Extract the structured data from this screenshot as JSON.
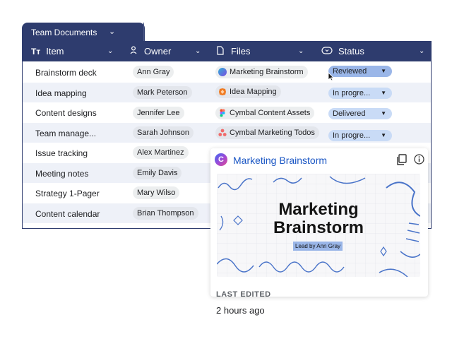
{
  "tab": {
    "label": "Team Documents"
  },
  "columns": [
    {
      "label": "Item",
      "icon": "text-type-icon"
    },
    {
      "label": "Owner",
      "icon": "person-icon"
    },
    {
      "label": "Files",
      "icon": "file-icon"
    },
    {
      "label": "Status",
      "icon": "toggle-status-icon"
    }
  ],
  "rows": [
    {
      "item": "Brainstorm deck",
      "owner": "Ann Gray",
      "file": "Marketing Brainstorm",
      "status": "Reviewed"
    },
    {
      "item": "Idea mapping",
      "owner": "Mark Peterson",
      "file": "Idea Mapping",
      "status": "In progre..."
    },
    {
      "item": "Content designs",
      "owner": "Jennifer Lee",
      "file": "Cymbal Content Assets",
      "status": "Delivered"
    },
    {
      "item": "Team manage...",
      "owner": "Sarah Johnson",
      "file": "Cymbal Marketing Todos",
      "status": "In progre..."
    },
    {
      "item": "Issue tracking",
      "owner": "Alex Martinez"
    },
    {
      "item": "Meeting notes",
      "owner": "Emily Davis"
    },
    {
      "item": "Strategy 1-Pager",
      "owner": "Mary Wilso"
    },
    {
      "item": "Content calendar",
      "owner": "Brian Thompson"
    }
  ],
  "popup": {
    "title": "Marketing Brainstorm",
    "preview_title_line1": "Marketing",
    "preview_title_line2": "Brainstorm",
    "preview_lead": "Lead by Ann Gray",
    "last_edited_label": "LAST EDITED",
    "last_edited_value": "2 hours ago"
  },
  "colors": {
    "header": "#2e3c6e",
    "status_blue": "#c9dbf6",
    "status_reviewed": "#9ab6e8"
  }
}
